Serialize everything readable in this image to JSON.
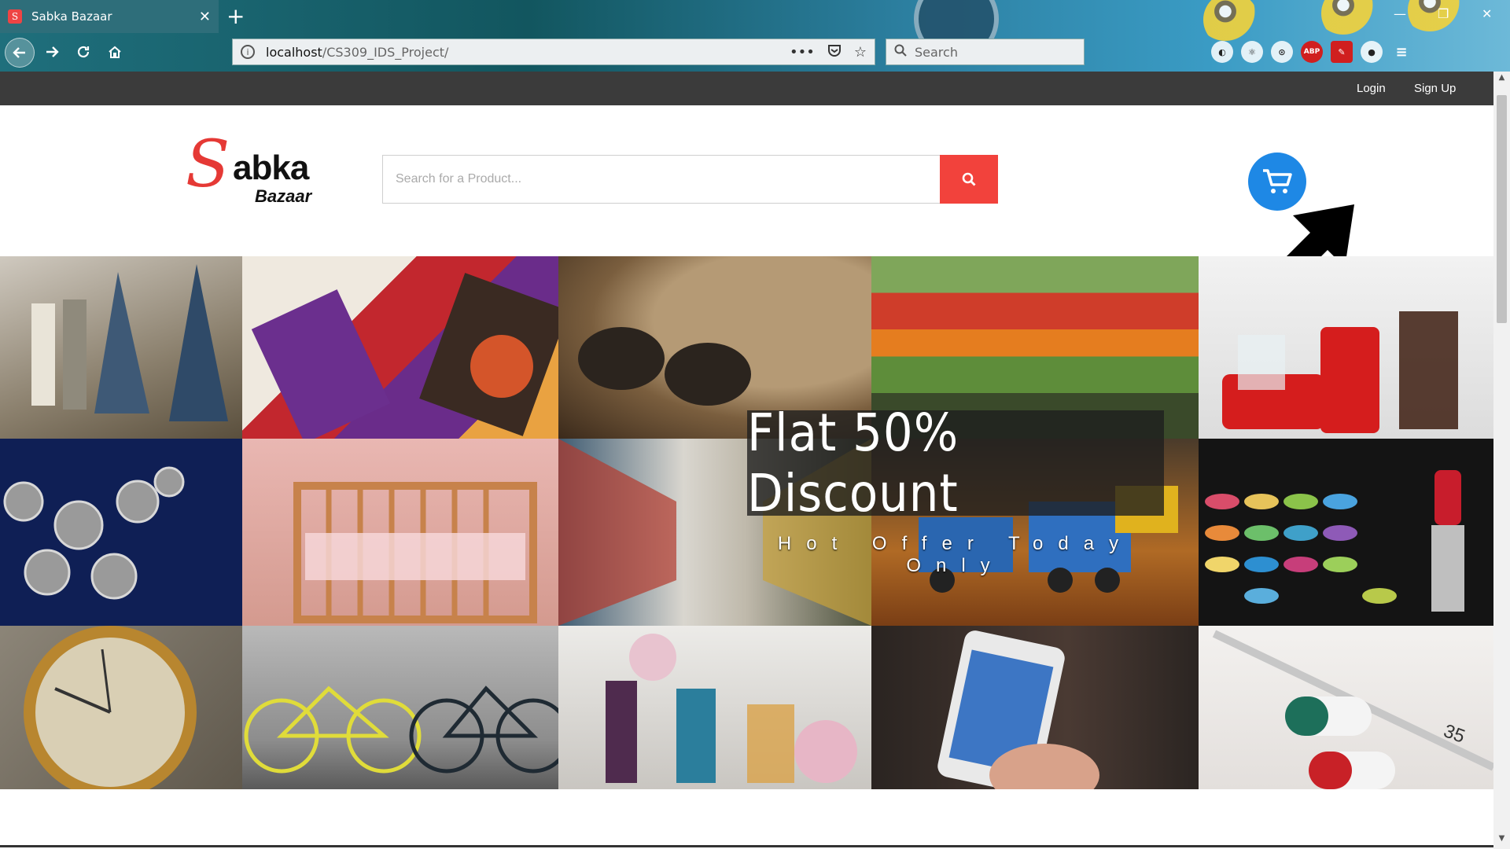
{
  "browser": {
    "tab_title": "Sabka Bazaar",
    "tab_close": "✕",
    "new_tab": "+",
    "url_host": "localhost",
    "url_path": "/CS309_IDS_Project/",
    "search_placeholder": "Search",
    "toolbar_icons": [
      "ABP"
    ]
  },
  "site": {
    "top_nav": {
      "login": "Login",
      "signup": "Sign Up"
    },
    "logo": {
      "initial": "S",
      "word1": "abka",
      "word2": "Bazaar"
    },
    "search": {
      "placeholder": "Search for a Product..."
    },
    "colors": {
      "accent_red": "#f2423c",
      "cart_blue": "#1e88e5",
      "topbar": "#3b3b3b"
    }
  },
  "banner": {
    "headline": "Flat 50% Discount",
    "subline": "Hot Offer Today Only",
    "tiles": [
      "fashion-mannequins",
      "handbags",
      "hat-sunglasses",
      "vegetables",
      "coca-cola",
      "necklace",
      "baby-crib",
      "supermarket-aisle",
      "toy-train",
      "makeup-palette",
      "wristwatch",
      "bicycles",
      "perfumes",
      "smartphone",
      "pills-thermometer"
    ]
  }
}
